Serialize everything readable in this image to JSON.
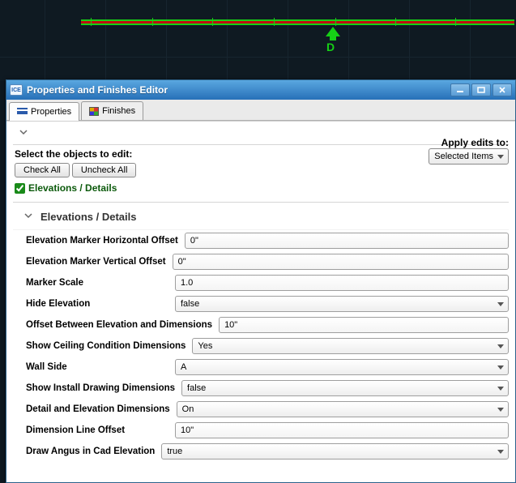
{
  "cad": {
    "marker_label": "D"
  },
  "dialog": {
    "title": "Properties and Finishes Editor",
    "app_icon_text": "ICE"
  },
  "tabs": {
    "properties": "Properties",
    "finishes": "Finishes"
  },
  "header": {
    "select_label": "Select the objects to edit:",
    "check_all": "Check All",
    "uncheck_all": "Uncheck All",
    "apply_label": "Apply edits to:",
    "apply_value": "Selected Items",
    "checkbox_label": "Elevations / Details"
  },
  "section": {
    "title": "Elevations / Details"
  },
  "props": {
    "horiz_offset_label": "Elevation Marker Horizontal Offset",
    "horiz_offset_value": "0\"",
    "vert_offset_label": "Elevation Marker Vertical Offset",
    "vert_offset_value": "0\"",
    "marker_scale_label": "Marker Scale",
    "marker_scale_value": "1.0",
    "hide_elevation_label": "Hide Elevation",
    "hide_elevation_value": "false",
    "offset_dims_label": "Offset Between Elevation and Dimensions",
    "offset_dims_value": "10\"",
    "show_ceiling_label": "Show Ceiling Condition Dimensions",
    "show_ceiling_value": "Yes",
    "wall_side_label": "Wall Side",
    "wall_side_value": "A",
    "show_install_label": "Show Install Drawing Dimensions",
    "show_install_value": "false",
    "detail_elev_label": "Detail and Elevation Dimensions",
    "detail_elev_value": "On",
    "dim_line_offset_label": "Dimension Line Offset",
    "dim_line_offset_value": "10\"",
    "draw_angus_label": "Draw Angus in Cad Elevation",
    "draw_angus_value": "true"
  }
}
